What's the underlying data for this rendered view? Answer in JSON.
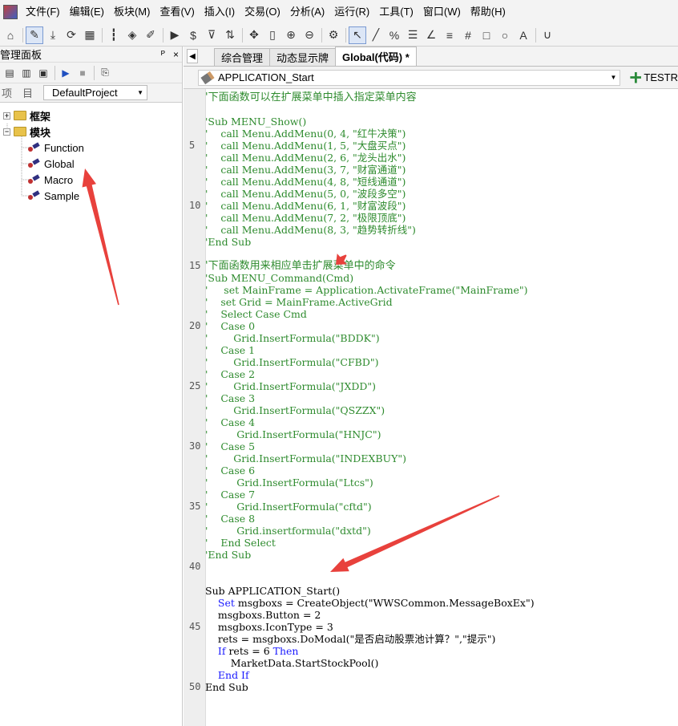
{
  "menu": [
    "文件(F)",
    "编辑(E)",
    "板块(M)",
    "查看(V)",
    "插入(I)",
    "交易(O)",
    "分析(A)",
    "运行(R)",
    "工具(T)",
    "窗口(W)",
    "帮助(H)"
  ],
  "toolbar_icons": [
    "home-icon",
    "pencil-icon",
    "download-icon",
    "refresh-icon",
    "grid-icon",
    "candles-icon",
    "diamond-icon",
    "edit-icon",
    "play-icon",
    "dollar-icon",
    "filter-icon",
    "sort-icon",
    "move-icon",
    "ruler-icon",
    "zoom-in-icon",
    "zoom-out-icon",
    "settings-icon",
    "cursor-icon",
    "line-icon",
    "percent-icon",
    "hbar-icon",
    "angle-icon",
    "list-icon",
    "hash-icon",
    "rect-icon",
    "circle-icon",
    "text-icon",
    "magnet-icon"
  ],
  "left_panel": {
    "title": "管理面板",
    "pin": "ᴾ",
    "close": "×",
    "project_label": "项　目",
    "project_value": "DefaultProject",
    "tree": [
      {
        "label": "框架",
        "kind": "folder",
        "expanded": false
      },
      {
        "label": "模块",
        "kind": "folder",
        "expanded": true
      },
      {
        "label": "Function",
        "kind": "leaf"
      },
      {
        "label": "Global",
        "kind": "leaf"
      },
      {
        "label": "Macro",
        "kind": "leaf"
      },
      {
        "label": "Sample",
        "kind": "leaf"
      }
    ]
  },
  "tabs": [
    {
      "label": "综合管理",
      "active": false
    },
    {
      "label": "动态显示牌",
      "active": false
    },
    {
      "label": "Global(代码) *",
      "active": true
    }
  ],
  "procedure": {
    "value": "APPLICATION_Start",
    "test_label": "TESTR"
  },
  "line_numbers": [
    "5",
    "10",
    "15",
    "20",
    "25",
    "30",
    "35",
    "40",
    "45",
    "50"
  ],
  "code_lines": [
    {
      "t": "'下面函数可以在扩展菜单中插入指定菜单内容",
      "s": "cmtcn"
    },
    {
      "t": "",
      "s": "code"
    },
    {
      "t": "'Sub MENU_Show()",
      "s": "cmt"
    },
    {
      "t": "'    call Menu.AddMenu(0, 4, \"红牛决策\")",
      "s": "cmt"
    },
    {
      "t": "'    call Menu.AddMenu(1, 5, \"大盘买点\")",
      "s": "cmt"
    },
    {
      "t": "'    call Menu.AddMenu(2, 6, \"龙头出水\")",
      "s": "cmt"
    },
    {
      "t": "'    call Menu.AddMenu(3, 7, \"财富通道\")",
      "s": "cmt"
    },
    {
      "t": "'    call Menu.AddMenu(4, 8, \"短线通道\")",
      "s": "cmt"
    },
    {
      "t": "'    call Menu.AddMenu(5, 0, \"波段多空\")",
      "s": "cmt"
    },
    {
      "t": "'    call Menu.AddMenu(6, 1, \"财富波段\")",
      "s": "cmt"
    },
    {
      "t": "'    call Menu.AddMenu(7, 2, \"极限顶底\")",
      "s": "cmt"
    },
    {
      "t": "'    call Menu.AddMenu(8, 3, \"趋势转折线\")",
      "s": "cmt"
    },
    {
      "t": "'End Sub",
      "s": "cmt"
    },
    {
      "t": "",
      "s": "code"
    },
    {
      "t": "'下面函数用来相应单击扩展菜单中的命令",
      "s": "cmtcn"
    },
    {
      "t": "'Sub MENU_Command(Cmd)",
      "s": "cmt"
    },
    {
      "t": "'     set MainFrame = Application.ActivateFrame(\"MainFrame\")",
      "s": "cmt"
    },
    {
      "t": "'    set Grid = MainFrame.ActiveGrid",
      "s": "cmt"
    },
    {
      "t": "'    Select Case Cmd",
      "s": "cmt"
    },
    {
      "t": "'    Case 0",
      "s": "cmt"
    },
    {
      "t": "'        Grid.InsertFormula(\"BDDK\")",
      "s": "cmt"
    },
    {
      "t": "'    Case 1",
      "s": "cmt"
    },
    {
      "t": "'        Grid.InsertFormula(\"CFBD\")",
      "s": "cmt"
    },
    {
      "t": "'    Case 2",
      "s": "cmt"
    },
    {
      "t": "'        Grid.InsertFormula(\"JXDD\")",
      "s": "cmt"
    },
    {
      "t": "'    Case 3",
      "s": "cmt"
    },
    {
      "t": "'        Grid.InsertFormula(\"QSZZX\")",
      "s": "cmt"
    },
    {
      "t": "'    Case 4",
      "s": "cmt"
    },
    {
      "t": "'         Grid.InsertFormula(\"HNJC\")",
      "s": "cmt"
    },
    {
      "t": "'    Case 5",
      "s": "cmt"
    },
    {
      "t": "'        Grid.InsertFormula(\"INDEXBUY\")",
      "s": "cmt"
    },
    {
      "t": "'    Case 6",
      "s": "cmt"
    },
    {
      "t": "'         Grid.InsertFormula(\"Ltcs\")",
      "s": "cmt"
    },
    {
      "t": "'    Case 7",
      "s": "cmt"
    },
    {
      "t": "'         Grid.InsertFormula(\"cftd\")",
      "s": "cmt"
    },
    {
      "t": "'    Case 8",
      "s": "cmt"
    },
    {
      "t": "'         Grid.insertformula(\"dxtd\")",
      "s": "cmt"
    },
    {
      "t": "'    End Select",
      "s": "cmt"
    },
    {
      "t": "'End Sub",
      "s": "cmt"
    },
    {
      "t": "",
      "s": "code"
    },
    {
      "t": "",
      "s": "code"
    },
    {
      "t": "Sub APPLICATION_Start()",
      "s": "code"
    },
    {
      "t": "    Set msgboxs = CreateObject(\"WWSCommon.MessageBoxEx\")",
      "s": "code"
    },
    {
      "t": "    msgboxs.Button = 2",
      "s": "code"
    },
    {
      "t": "    msgboxs.IconType = 3",
      "s": "code"
    },
    {
      "t": "    rets = msgboxs.DoModal(\"是否启动股票池计算？\",\"提示\")",
      "s": "code"
    },
    {
      "t": "    If rets = 6 Then",
      "s": "code"
    },
    {
      "t": "        MarketData.StartStockPool()",
      "s": "code"
    },
    {
      "t": "    End If",
      "s": "code"
    },
    {
      "t": "End Sub",
      "s": "code"
    }
  ],
  "annotation_color": "#e8413c"
}
